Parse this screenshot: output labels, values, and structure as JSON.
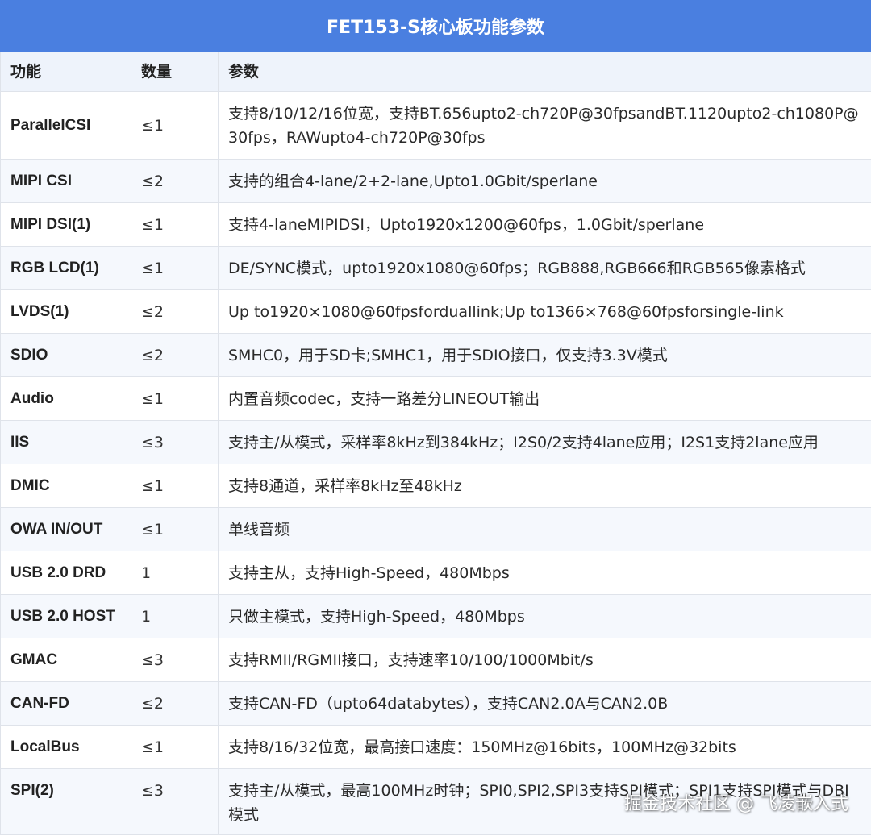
{
  "title": "FET153-S核心板功能参数",
  "columns": [
    "功能",
    "数量",
    "参数"
  ],
  "rows": [
    {
      "function": "ParallelCSI",
      "qty": "≤1",
      "params": "支持8/10/12/16位宽，支持BT.656upto2-ch720P@30fpsandBT.1120upto2-ch1080P@30fps，RAWupto4-ch720P@30fps"
    },
    {
      "function": "MIPI CSI",
      "qty": "≤2",
      "params": "支持的组合4-lane/2+2-lane,Upto1.0Gbit/sperlane"
    },
    {
      "function": "MIPI DSI(1)",
      "qty": "≤1",
      "params": "支持4-laneMIPIDSI，Upto1920x1200@60fps，1.0Gbit/sperlane"
    },
    {
      "function": "RGB LCD(1)",
      "qty": "≤1",
      "params": "DE/SYNC模式，upto1920x1080@60fps；RGB888,RGB666和RGB565像素格式"
    },
    {
      "function": "LVDS(1)",
      "qty": "≤2",
      "params": "Up to1920×1080@60fpsforduallink;Up to1366×768@60fpsforsingle-link"
    },
    {
      "function": "SDIO",
      "qty": "≤2",
      "params": "SMHC0，用于SD卡;SMHC1，用于SDIO接口，仅支持3.3V模式"
    },
    {
      "function": "Audio",
      "qty": "≤1",
      "params": "内置音频codec，支持一路差分LINEOUT输出"
    },
    {
      "function": "IIS",
      "qty": "≤3",
      "params": "支持主/从模式，采样率8kHz到384kHz；I2S0/2支持4lane应用；I2S1支持2lane应用"
    },
    {
      "function": "DMIC",
      "qty": "≤1",
      "params": "支持8通道，采样率8kHz至48kHz"
    },
    {
      "function": "OWA IN/OUT",
      "qty": "≤1",
      "params": "单线音频"
    },
    {
      "function": "USB 2.0 DRD",
      "qty": "1",
      "params": "支持主从，支持High-Speed，480Mbps"
    },
    {
      "function": "USB 2.0 HOST",
      "qty": "1",
      "params": "只做主模式，支持High-Speed，480Mbps"
    },
    {
      "function": "GMAC",
      "qty": "≤3",
      "params": "支持RMII/RGMII接口，支持速率10/100/1000Mbit/s"
    },
    {
      "function": "CAN-FD",
      "qty": "≤2",
      "params": "支持CAN-FD（upto64databytes），支持CAN2.0A与CAN2.0B"
    },
    {
      "function": "LocalBus",
      "qty": "≤1",
      "params": "支持8/16/32位宽，最高接口速度：150MHz@16bits，100MHz@32bits"
    },
    {
      "function": "SPI(2)",
      "qty": "≤3",
      "params": "支持主/从模式，最高100MHz时钟；SPI0,SPI2,SPI3支持SPI模式；SPI1支持SPI模式与DBI模式"
    }
  ],
  "watermark": "掘金技术社区 @ 飞凌嵌入式",
  "colors": {
    "title_bg": "#4a7fe0",
    "header_bg": "#eef3fb",
    "border": "#dfe3ea"
  }
}
